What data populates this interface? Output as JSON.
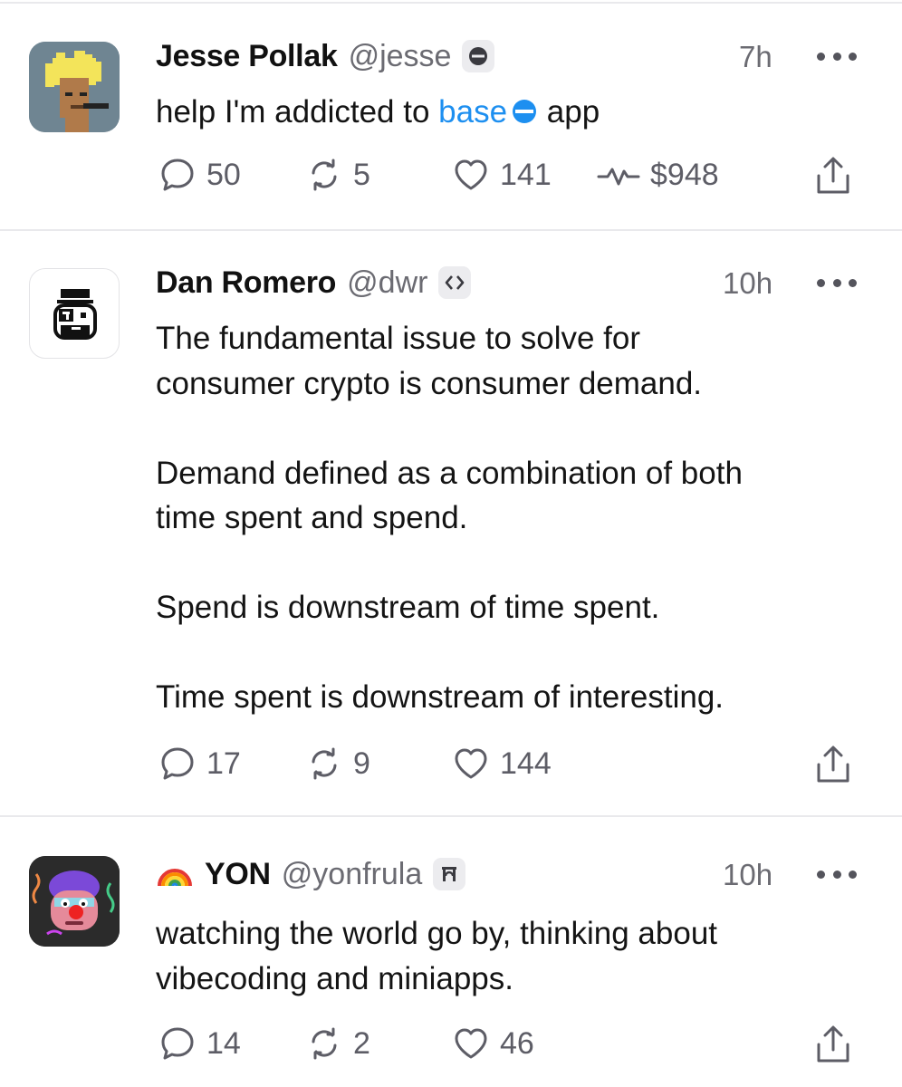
{
  "posts": [
    {
      "name": "Jesse Pollak",
      "handle": "@jesse",
      "time": "7h",
      "text_before": "help I'm addicted to ",
      "link": "base",
      "text_after": " app",
      "replies": "50",
      "recasts": "5",
      "likes": "141",
      "tips": "$948"
    },
    {
      "name": "Dan Romero",
      "handle": "@dwr",
      "time": "10h",
      "text": "The fundamental issue to solve for\nconsumer crypto is consumer demand.\n\nDemand defined as a combination of both\ntime spent and spend.\n\nSpend is downstream of time spent.\n\nTime spent is downstream of interesting.",
      "replies": "17",
      "recasts": "9",
      "likes": "144"
    },
    {
      "emoji": "rainbow-emoji",
      "name": "YON",
      "handle": "@yonfrula",
      "time": "10h",
      "text": "watching the world go by, thinking about\nvibecoding and miniapps.",
      "replies": "14",
      "recasts": "2",
      "likes": "46"
    }
  ],
  "icons": {
    "reply": "comment-bubble-icon",
    "recast": "recast-arrows-icon",
    "like": "heart-icon",
    "tip": "pulse-icon",
    "share": "share-upload-icon",
    "more": "more-dots-icon"
  },
  "colors": {
    "link": "#1d8ff0",
    "base_brand": "#0052ff",
    "muted_text": "#6b6b72"
  }
}
